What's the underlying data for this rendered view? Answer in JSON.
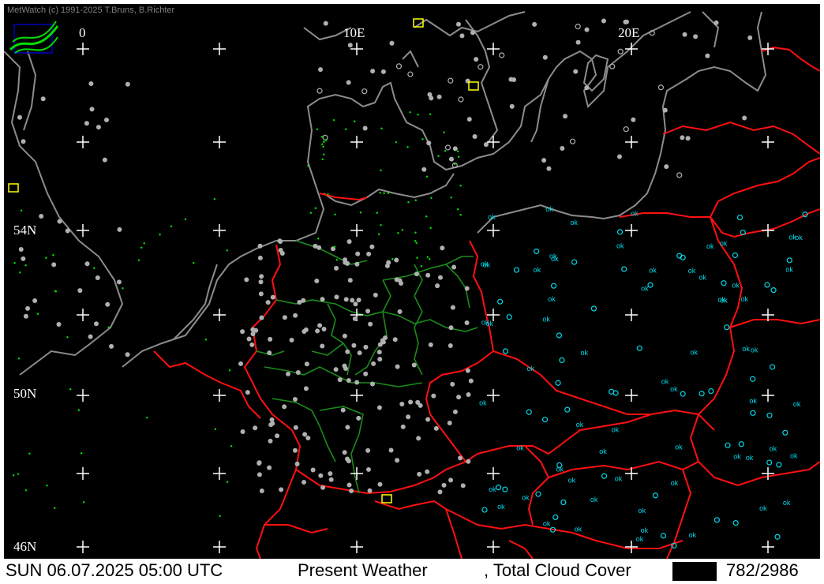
{
  "copyright": "MetWatch  (c) 1991-2025 T.Bruns, B.Richter",
  "logo": {
    "name": "metwatch-logo-icon"
  },
  "graticule": {
    "longitudes": [
      "0",
      "10E",
      "20E"
    ],
    "latitudes": [
      "54N",
      "50N",
      "46N"
    ]
  },
  "status": {
    "datetime": "SUN 06.07.2025 05:00 UTC",
    "product": "Present Weather",
    "overlay": ", Total Cloud Cover",
    "count": "782/2986"
  },
  "colors": {
    "background": "#000000",
    "coast": "#8c8c8c",
    "border": "#ff0000",
    "state_border": "#1a8c1a",
    "cross": "#ffffff",
    "station_grey": "#b0b0b0",
    "station_cyan": "#00d8e8",
    "weather_green": "#00e000",
    "weather_yellow": "#ffff00"
  }
}
